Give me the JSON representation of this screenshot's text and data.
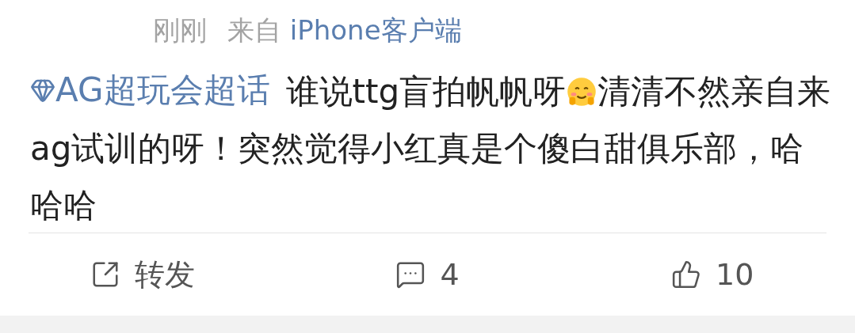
{
  "post": {
    "time": "刚刚",
    "source_prefix": "来自",
    "source": "iPhone客户端",
    "topic": "AG超玩会超话",
    "body_start": "谁说ttg盲拍帆帆呀",
    "body_end": "清清不然亲自来ag试训的呀！突然觉得小红真是个傻白甜俱乐部，哈哈哈"
  },
  "actions": [
    {
      "kind": "repost",
      "label": "转发"
    },
    {
      "kind": "comment",
      "label": "4"
    },
    {
      "kind": "like",
      "label": "10"
    }
  ]
}
